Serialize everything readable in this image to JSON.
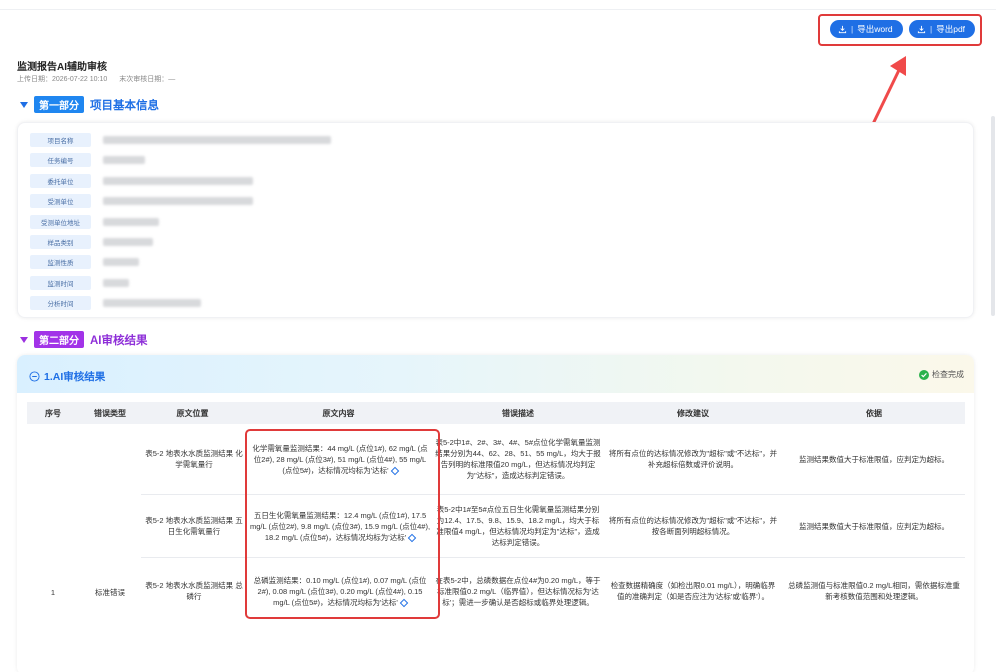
{
  "toolbar": {
    "export_word": "导出word",
    "export_pdf": "导出pdf",
    "separator": "|"
  },
  "report": {
    "title": "监测报告AI辅助审核",
    "upload_label": "上传日期：",
    "upload_date": "2026-07-22 10:10",
    "last_review_label": "末次审核日期：",
    "last_review_date": "—"
  },
  "section1": {
    "badge": "第一部分",
    "title": "项目基本信息",
    "fields": [
      {
        "label": "项目名称"
      },
      {
        "label": "任务编号"
      },
      {
        "label": "委托单位"
      },
      {
        "label": "受测单位"
      },
      {
        "label": "受测单位地址"
      },
      {
        "label": "样品类别"
      },
      {
        "label": "监测性质"
      },
      {
        "label": "监测时间"
      },
      {
        "label": "分析时间"
      }
    ]
  },
  "section2": {
    "badge": "第二部分",
    "title": "AI审核结果",
    "card_title": "1.AI审核结果",
    "status": "检查完成",
    "columns": [
      "序号",
      "错误类型",
      "原文位置",
      "原文内容",
      "错误描述",
      "修改建议",
      "依据"
    ],
    "row_number": "1",
    "error_type": "标准错误",
    "rows": [
      {
        "location": "表5-2 地表水水质监测结果 化学需氧量行",
        "content": "化学需氧量监测结果：44 mg/L (点位1#), 62 mg/L (点位2#), 28 mg/L (点位3#), 51 mg/L (点位4#), 55 mg/L (点位5#)，达标情况均标为'达标'",
        "description": "表5-2中1#、2#、3#、4#、5#点位化学需氧量监测结果分别为44、62、28、51、55 mg/L，均大于报告列明的标准限值20 mg/L，但达标情况均判定为\"达标\"，造成达标判定错误。",
        "suggestion": "将所有点位的达标情况修改为\"超标\"或\"不达标\"，并补充超标倍数或评价说明。",
        "basis": "监测结果数值大于标准限值，应判定为超标。"
      },
      {
        "location": "表5-2 地表水水质监测结果 五日生化需氧量行",
        "content": "五日生化需氧量监测结果：12.4 mg/L (点位1#), 17.5 mg/L (点位2#), 9.8 mg/L (点位3#), 15.9 mg/L (点位4#), 18.2 mg/L (点位5#)，达标情况均标为'达标'",
        "description": "表5-2中1#至5#点位五日生化需氧量监测结果分别为12.4、17.5、9.8、15.9、18.2 mg/L，均大于标准限值4 mg/L，但达标情况均判定为\"达标\"，造成达标判定错误。",
        "suggestion": "将所有点位的达标情况修改为\"超标\"或\"不达标\"，并按各断面列明超标情况。",
        "basis": "监测结果数值大于标准限值，应判定为超标。"
      },
      {
        "location": "表5-2 地表水水质监测结果 总磷行",
        "content": "总磷监测结果：0.10 mg/L (点位1#), 0.07 mg/L (点位2#), 0.08 mg/L (点位3#), 0.20 mg/L (点位4#), 0.15 mg/L (点位5#)，达标情况均标为'达标'",
        "description": "在表5-2中，总磷数据在点位4#为0.20 mg/L，等于标准限值0.2 mg/L（临界值），但达标情况标为'达标'；需进一步确认是否超标或临界处理逻辑。",
        "suggestion": "检查数据精确度（如检出限0.01 mg/L），明确临界值的准确判定（如是否应注为'达标'或'临界'）。",
        "basis": "总磷监测值与标准限值0.2 mg/L相同，需依据标准重新考核数值范围和处理逻辑。"
      }
    ]
  }
}
